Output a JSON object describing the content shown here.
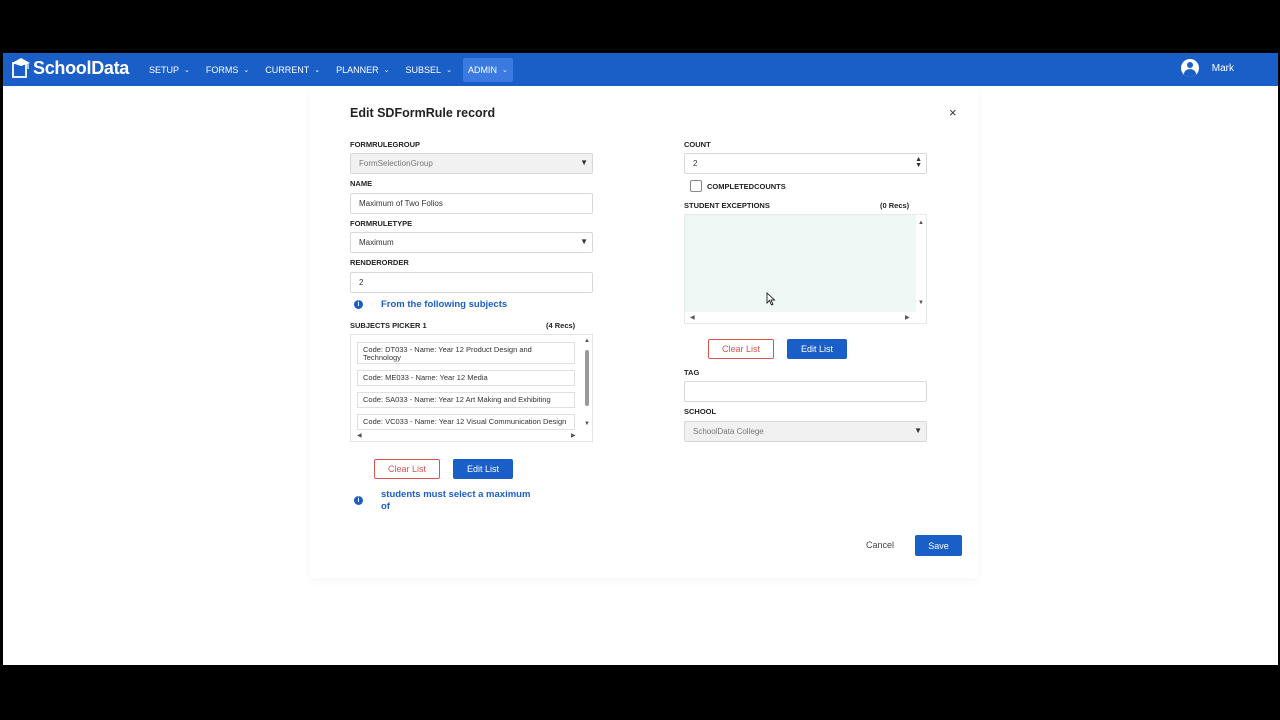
{
  "app": {
    "logo_text": "SchoolData"
  },
  "nav": {
    "items": [
      {
        "label": "SETUP"
      },
      {
        "label": "FORMS"
      },
      {
        "label": "CURRENT"
      },
      {
        "label": "PLANNER"
      },
      {
        "label": "SUBSEL"
      },
      {
        "label": "ADMIN",
        "active": true
      }
    ],
    "user_name": "Mark"
  },
  "modal": {
    "title": "Edit SDFormRule record",
    "close": "×",
    "formrulegroup": {
      "label": "FORMRULEGROUP",
      "value": "FormSelectionGroup"
    },
    "name": {
      "label": "NAME",
      "value": "Maximum of Two Folios"
    },
    "formruletype": {
      "label": "FORMRULETYPE",
      "value": "Maximum"
    },
    "renderorder": {
      "label": "RENDERORDER",
      "value": "2"
    },
    "info_subjects": "From the following subjects",
    "subjects_picker": {
      "label": "SUBJECTS PICKER 1",
      "count": "(4 Recs)",
      "items": [
        "Code: DT033 - Name: Year 12 Product Design and Technology",
        "Code: ME033 - Name: Year 12 Media",
        "Code: SA033 - Name: Year 12 Art Making and Exhibiting",
        "Code: VC033 - Name: Year 12 Visual Communication Design"
      ]
    },
    "clear_list": "Clear List",
    "edit_list": "Edit List",
    "info_max": "students must select a maximum of",
    "count": {
      "label": "COUNT",
      "value": "2"
    },
    "completedcounts": {
      "label": "COMPLETEDCOUNTS",
      "checked": false
    },
    "student_exceptions": {
      "label": "STUDENT EXCEPTIONS",
      "count": "(0 Recs)"
    },
    "tag": {
      "label": "TAG",
      "value": ""
    },
    "school": {
      "label": "SCHOOL",
      "value": "SchoolData College"
    },
    "cancel": "Cancel",
    "save": "Save"
  },
  "colors": {
    "brand": "#1a5fc8",
    "danger": "#d9534f",
    "exceptions_bg": "#eef8f4"
  }
}
